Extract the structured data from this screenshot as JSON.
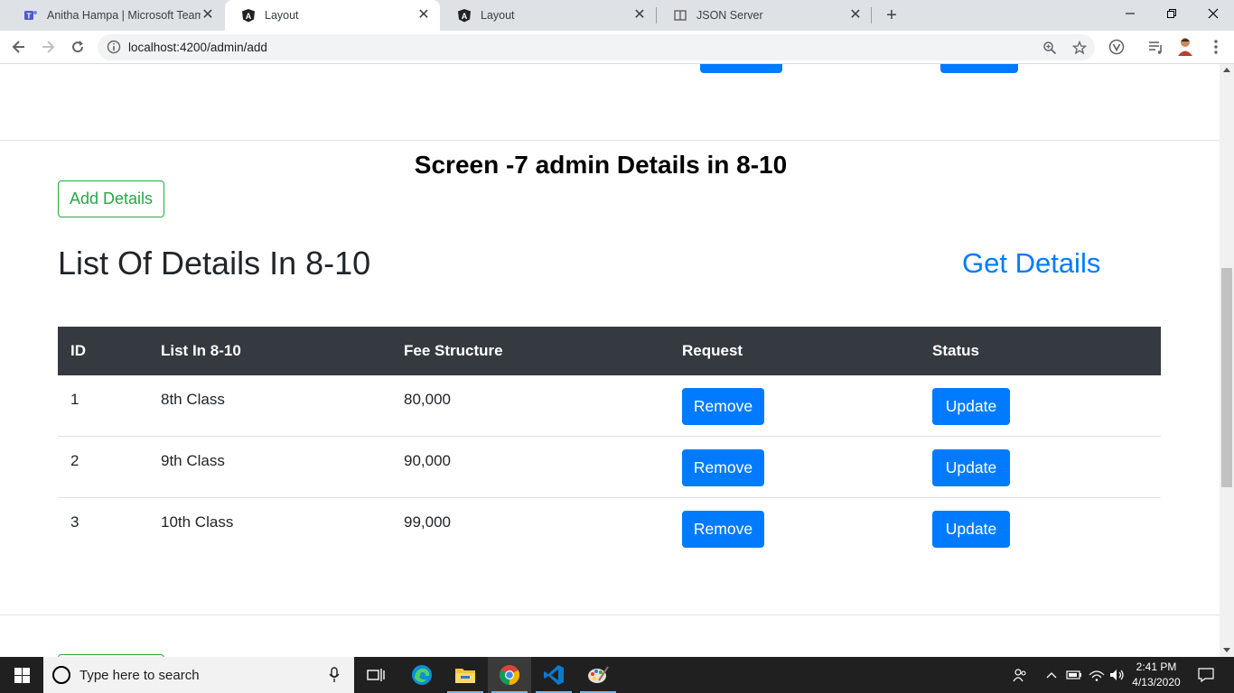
{
  "browser": {
    "tabs": [
      {
        "title": "Anitha Hampa | Microsoft Teams",
        "icon": "teams-icon"
      },
      {
        "title": "Layout",
        "icon": "angular-icon"
      },
      {
        "title": "Layout",
        "icon": "angular-icon"
      },
      {
        "title": "JSON Server",
        "icon": "json-server-icon"
      }
    ],
    "active_tab": 1,
    "url": "localhost:4200/admin/add"
  },
  "page": {
    "screen_title": "Screen -7 admin Details in 8-10",
    "add_details_label": "Add Details",
    "list_title": "List Of Details In 8-10",
    "get_details_label": "Get Details",
    "table": {
      "headers": [
        "ID",
        "List In 8-10",
        "Fee Structure",
        "Request",
        "Status"
      ],
      "rows": [
        {
          "id": "1",
          "name": "8th Class",
          "fee": "80,000",
          "request": "Remove",
          "status": "Update"
        },
        {
          "id": "2",
          "name": "9th Class",
          "fee": "90,000",
          "request": "Remove",
          "status": "Update"
        },
        {
          "id": "3",
          "name": "10th Class",
          "fee": "99,000",
          "request": "Remove",
          "status": "Update"
        }
      ]
    }
  },
  "taskbar": {
    "search_placeholder": "Type here to search",
    "time": "2:41 PM",
    "date": "4/13/2020",
    "apps": [
      "task-view-icon",
      "edge-icon",
      "file-explorer-icon",
      "chrome-icon",
      "vscode-icon",
      "paint-icon"
    ]
  },
  "colors": {
    "primary": "#007bff",
    "success": "#28a745",
    "table_header": "#343a40"
  }
}
